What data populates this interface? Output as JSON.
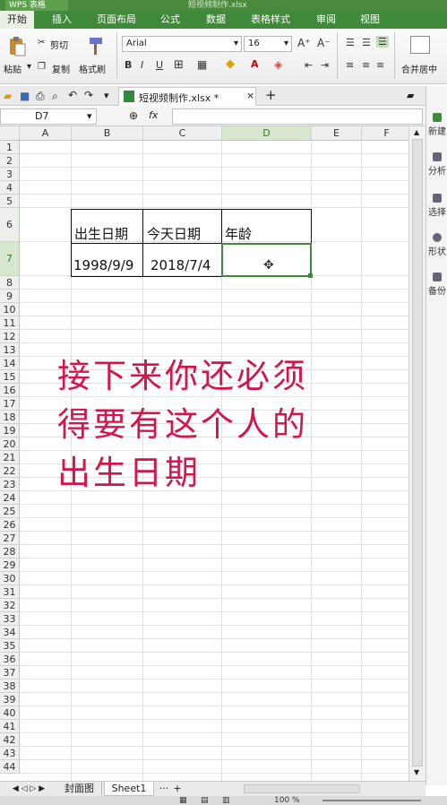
{
  "app": {
    "title": "WPS 表格",
    "window_title": "短视频制作.xlsx"
  },
  "menu": [
    "开始",
    "插入",
    "页面布局",
    "公式",
    "数据",
    "表格样式",
    "审阅",
    "视图"
  ],
  "ribbon": {
    "paste": "粘贴",
    "cut": "剪切",
    "copy": "复制",
    "format_painter": "格式刷",
    "font_name": "Arial",
    "font_size": "16",
    "bold": "B",
    "italic": "I",
    "underline": "U",
    "font_grow": "A⁺",
    "font_shrink": "A⁻",
    "fill_color_glyph": "A",
    "merge_center": "合并居中",
    "accent_color": "#3f8a3a"
  },
  "tab": {
    "filename": "短视频制作.xlsx *",
    "add": "+"
  },
  "formula": {
    "name_box": "D7",
    "fx": "fx",
    "value": ""
  },
  "columns": [
    "A",
    "B",
    "C",
    "D",
    "E",
    "F"
  ],
  "rows": [
    "1",
    "2",
    "3",
    "4",
    "5",
    "6",
    "7",
    "8",
    "9",
    "10",
    "11",
    "12",
    "13",
    "14",
    "15",
    "16",
    "17",
    "18",
    "19",
    "20",
    "21",
    "22",
    "23",
    "24",
    "25",
    "26",
    "27",
    "28",
    "29",
    "30",
    "31",
    "32",
    "33",
    "34",
    "35",
    "36",
    "37",
    "38",
    "39",
    "40",
    "41",
    "42",
    "43",
    "44"
  ],
  "cells": {
    "B6": "出生日期",
    "C6": "今天日期",
    "D6": "年龄",
    "B7": "1998/9/9",
    "C7": "2018/7/4",
    "D7": ""
  },
  "selected_cell": "D7",
  "annotation": [
    "接下来你还必须",
    "得要有这个人的",
    "出生日期"
  ],
  "annotation_color": "#d4144a",
  "right_panel": [
    "新建",
    "分析",
    "选择",
    "形状",
    "备份"
  ],
  "sheet_tabs": [
    "封面图",
    "Sheet1"
  ],
  "active_sheet": "Sheet1",
  "status": {
    "zoom": "100 %"
  }
}
